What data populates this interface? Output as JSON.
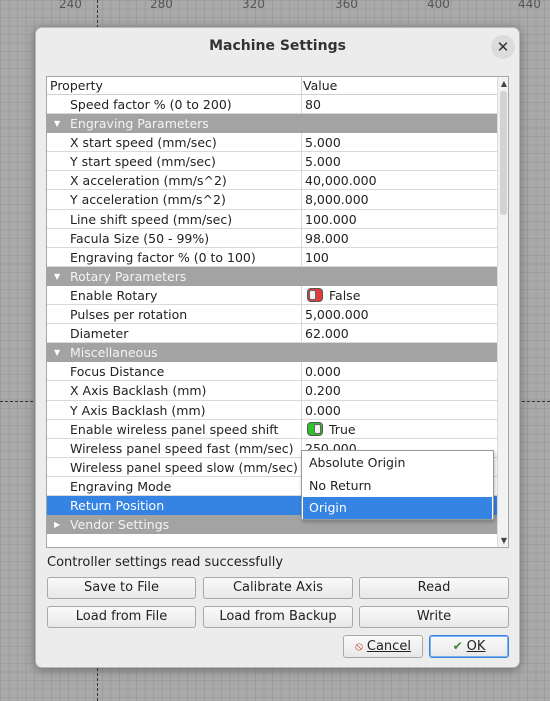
{
  "backdrop": {
    "ruler": [
      "240",
      "280",
      "320",
      "360",
      "400",
      "440"
    ]
  },
  "dialog": {
    "title": "Machine Settings",
    "close_glyph": "✕"
  },
  "grid": {
    "header": {
      "property": "Property",
      "value": "Value"
    },
    "rows": [
      {
        "type": "property",
        "label": "Speed factor % (0 to 200)",
        "value": "80"
      },
      {
        "type": "category",
        "label": "Engraving Parameters",
        "expanded": true
      },
      {
        "type": "property",
        "label": "X start speed (mm/sec)",
        "value": "5.000"
      },
      {
        "type": "property",
        "label": "Y start speed (mm/sec)",
        "value": "5.000"
      },
      {
        "type": "property",
        "label": "X acceleration (mm/s^2)",
        "value": "40,000.000"
      },
      {
        "type": "property",
        "label": "Y acceleration (mm/s^2)",
        "value": "8,000.000"
      },
      {
        "type": "property",
        "label": "Line shift speed (mm/sec)",
        "value": "100.000"
      },
      {
        "type": "property",
        "label": "Facula Size (50 - 99%)",
        "value": "98.000"
      },
      {
        "type": "property",
        "label": "Engraving factor % (0 to 100)",
        "value": "100"
      },
      {
        "type": "category",
        "label": "Rotary Parameters",
        "expanded": true
      },
      {
        "type": "bool",
        "label": "Enable Rotary",
        "value": "False",
        "on": false
      },
      {
        "type": "property",
        "label": "Pulses per rotation",
        "value": "5,000.000"
      },
      {
        "type": "property",
        "label": "Diameter",
        "value": "62.000"
      },
      {
        "type": "category",
        "label": "Miscellaneous",
        "expanded": true
      },
      {
        "type": "property",
        "label": "Focus Distance",
        "value": "0.000"
      },
      {
        "type": "property",
        "label": "X Axis Backlash (mm)",
        "value": "0.200"
      },
      {
        "type": "property",
        "label": "Y Axis Backlash (mm)",
        "value": "0.000"
      },
      {
        "type": "bool",
        "label": "Enable wireless panel speed shift",
        "value": "True",
        "on": true
      },
      {
        "type": "property",
        "label": "Wireless panel speed fast (mm/sec)",
        "value": "250.000"
      },
      {
        "type": "property",
        "label": "Wireless panel speed slow (mm/sec)",
        "value": ""
      },
      {
        "type": "property",
        "label": "Engraving Mode",
        "value": ""
      },
      {
        "type": "selected",
        "label": "Return Position",
        "value": ""
      },
      {
        "type": "category",
        "label": "Vendor Settings",
        "expanded": false
      }
    ],
    "dropdown_options": [
      "Absolute Origin",
      "No Return",
      "Origin"
    ],
    "dropdown_selected": "Origin"
  },
  "status": "Controller settings read successfully",
  "buttons": {
    "save_to_file": "Save to File",
    "calibrate_axis": "Calibrate Axis",
    "read": "Read",
    "load_from_file": "Load from File",
    "load_from_backup": "Load from Backup",
    "write": "Write",
    "cancel": "Cancel",
    "ok": "OK"
  },
  "icons": {
    "cancel": "cancel-icon",
    "ok": "ok-check-icon"
  },
  "colors": {
    "selection": "#3584e4",
    "category_band": "#a3a3a3",
    "toggle_off": "#e23b3b",
    "toggle_on": "#2fc22f"
  }
}
